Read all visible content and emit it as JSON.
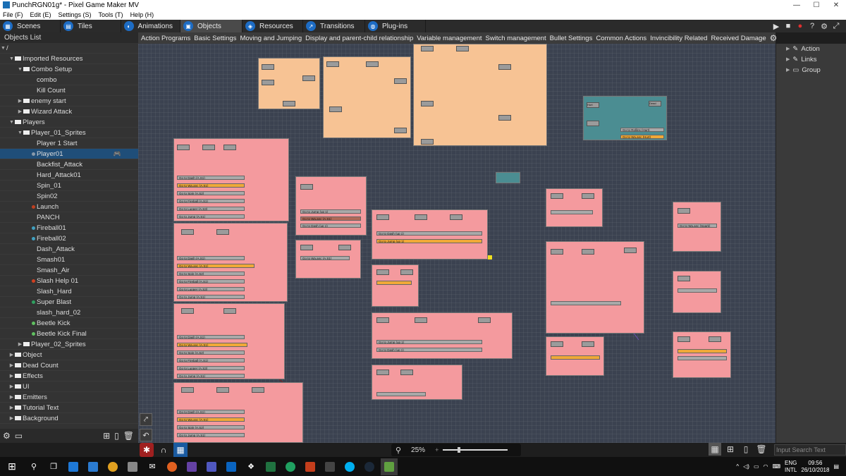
{
  "window": {
    "title": "PunchRGN01g* - Pixel Game Maker MV",
    "controls": [
      "—",
      "☐",
      "✕"
    ]
  },
  "menu": [
    "File (F)",
    "Edit (E)",
    "Settings (S)",
    "Tools (T)",
    "Help (H)"
  ],
  "tabs": [
    {
      "label": "Scenes",
      "icon": "scenes-icon"
    },
    {
      "label": "Tiles",
      "icon": "tiles-icon"
    },
    {
      "label": "Animations",
      "icon": "animations-icon"
    },
    {
      "label": "Objects",
      "icon": "objects-icon",
      "active": true
    },
    {
      "label": "Resources",
      "icon": "resources-icon"
    },
    {
      "label": "Transitions",
      "icon": "transitions-icon"
    },
    {
      "label": "Plug-ins",
      "icon": "plugins-icon"
    }
  ],
  "sidebar": {
    "header": "Objects List",
    "root": "/",
    "items": [
      {
        "label": "Imported Resources",
        "type": "folder",
        "arrow": "▼",
        "indent": 1
      },
      {
        "label": "Combo Setup",
        "type": "folder",
        "arrow": "▼",
        "indent": 2
      },
      {
        "label": "combo",
        "type": "object",
        "indent": 3
      },
      {
        "label": "Kill Count",
        "type": "object",
        "indent": 3
      },
      {
        "label": "enemy start",
        "type": "folder",
        "arrow": "▶",
        "indent": 2
      },
      {
        "label": "Wizard Attack",
        "type": "folder",
        "arrow": "▶",
        "indent": 2
      },
      {
        "label": "Players",
        "type": "folder",
        "arrow": "▼",
        "indent": 1
      },
      {
        "label": "Player_01_Sprites",
        "type": "folder",
        "arrow": "▼",
        "indent": 2
      },
      {
        "label": "Player 1 Start",
        "type": "object",
        "indent": 3
      },
      {
        "label": "Player01",
        "type": "object",
        "indent": 3,
        "selected": true,
        "dot": "#8899aa"
      },
      {
        "label": "Backfist_Attack",
        "type": "object",
        "indent": 3
      },
      {
        "label": "Hard_Attack01",
        "type": "object",
        "indent": 3
      },
      {
        "label": "Spin_01",
        "type": "object",
        "indent": 3
      },
      {
        "label": "Spin02",
        "type": "object",
        "indent": 3
      },
      {
        "label": "Launch",
        "type": "object",
        "indent": 3,
        "dot": "#c04020"
      },
      {
        "label": "PANCH",
        "type": "object",
        "indent": 3
      },
      {
        "label": "Fireball01",
        "type": "object",
        "indent": 3,
        "dot": "#40a0c0"
      },
      {
        "label": "Fireball02",
        "type": "object",
        "indent": 3,
        "dot": "#40a0c0"
      },
      {
        "label": "Dash_Attack",
        "type": "object",
        "indent": 3
      },
      {
        "label": "Smash01",
        "type": "object",
        "indent": 3
      },
      {
        "label": "Smash_Air",
        "type": "object",
        "indent": 3
      },
      {
        "label": "Slash Help 01",
        "type": "object",
        "indent": 3,
        "dot": "#d04020"
      },
      {
        "label": "Slash_Hard",
        "type": "object",
        "indent": 3
      },
      {
        "label": "Super Blast",
        "type": "object",
        "indent": 3,
        "dot": "#30a060"
      },
      {
        "label": "slash_hard_02",
        "type": "object",
        "indent": 3
      },
      {
        "label": "Beetle Kick",
        "type": "object",
        "indent": 3,
        "dot": "#60c060"
      },
      {
        "label": "Beetle Kick Final",
        "type": "object",
        "indent": 3,
        "dot": "#60c060"
      },
      {
        "label": "Player_02_Sprites",
        "type": "folder",
        "arrow": "▶",
        "indent": 2
      },
      {
        "label": "Object",
        "type": "folder",
        "arrow": "▶",
        "indent": 1
      },
      {
        "label": "Dead Count",
        "type": "folder",
        "arrow": "▶",
        "indent": 1
      },
      {
        "label": "Effects",
        "type": "folder",
        "arrow": "▶",
        "indent": 1
      },
      {
        "label": "UI",
        "type": "folder",
        "arrow": "▶",
        "indent": 1
      },
      {
        "label": "Emitters",
        "type": "folder",
        "arrow": "▶",
        "indent": 1
      },
      {
        "label": "Tutorial Text",
        "type": "folder",
        "arrow": "▶",
        "indent": 1
      },
      {
        "label": "Background",
        "type": "folder",
        "arrow": "▶",
        "indent": 1
      }
    ]
  },
  "categories": [
    "Action Programs",
    "Basic Settings",
    "Moving and Jumping",
    "Display and parent-child relationship",
    "Variable management",
    "Switch management",
    "Bullet Settings",
    "Common Actions",
    "Invincibility Related",
    "Received Damage"
  ],
  "right_panel": {
    "items": [
      "Action",
      "Links",
      "Group"
    ],
    "search_placeholder": "Input Search Text"
  },
  "zoom": {
    "value": "25%",
    "level": 0.25
  },
  "canvas_nodes": {
    "n1_bar": "Go to Dash (A.S1)",
    "n1_bar2": "Go to Wa.anc (A.S1)",
    "teal_bar1": "Go to Rollins (Hurt)",
    "teal_bar2": "Go to Wa.anc (Hurt)",
    "teal_dead": "Dead",
    "teal_hurt": "Hurt",
    "jump_bar": "Go to Jump (A.S1)",
    "spin_bar": "Go to Spin (A.S2)",
    "fire_bar": "Go to Fireball (A.S1)",
    "lupper_bar": "Go to Lupper (A.S3)",
    "mid_bar1": "Go to Dash (up 1)",
    "mid_bar2": "Go to Jump (up 1)",
    "right_bar": "Go to Wa.anc (Spark)"
  },
  "taskbar": {
    "language": [
      "ENG",
      "INTL"
    ],
    "time": "09:56",
    "date": "26/10/2018"
  },
  "colors": {
    "tab_active": "#4a4a4a",
    "selection": "#1f4e79",
    "node_peach": "#f7c394",
    "node_pink": "#f49a9e",
    "node_teal": "#4b8d92",
    "link_orange": "#f0a938"
  }
}
